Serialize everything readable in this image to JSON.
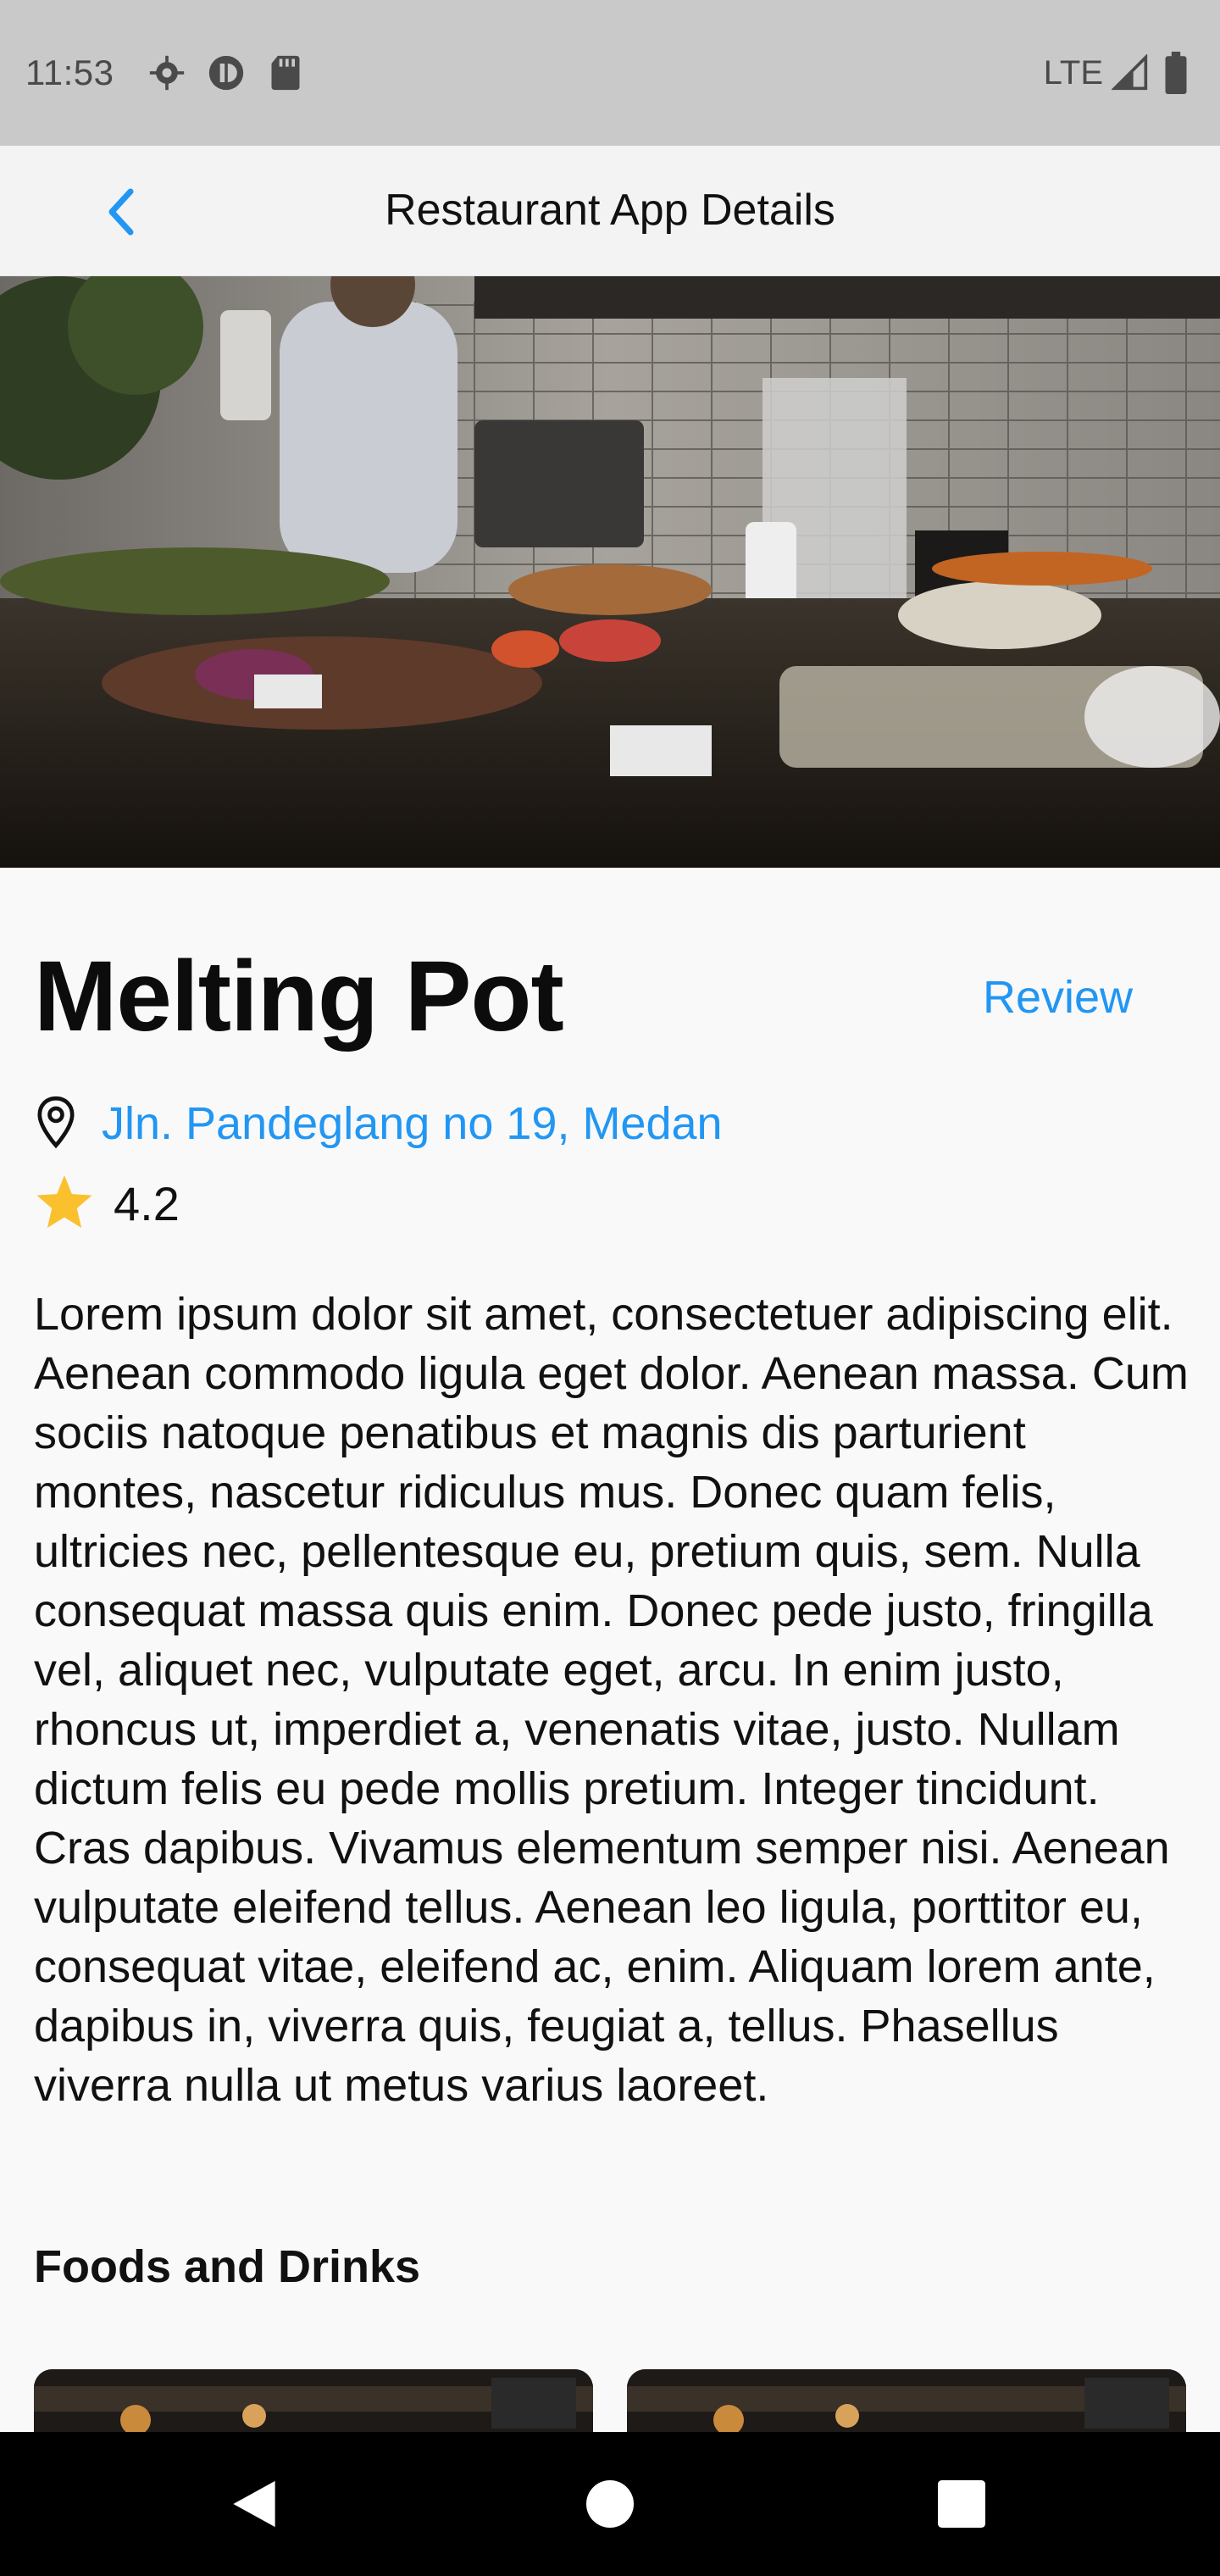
{
  "status_bar": {
    "time": "11:53",
    "network": "LTE",
    "icons": [
      "settings-icon",
      "privacy-icon",
      "sd-card-icon",
      "signal-icon",
      "battery-icon"
    ]
  },
  "app_bar": {
    "title": "Restaurant App Details",
    "back_icon": "chevron-left-icon"
  },
  "restaurant": {
    "name": "Melting Pot",
    "review_label": "Review",
    "address": "Jln. Pandeglang no 19, Medan",
    "rating": "4.2",
    "description": "Lorem ipsum dolor sit amet, consectetuer adipiscing elit. Aenean commodo ligula eget dolor. Aenean massa. Cum sociis natoque penatibus et magnis dis parturient montes, nascetur ridiculus mus. Donec quam felis, ultricies nec, pellentesque eu, pretium quis, sem. Nulla consequat massa quis enim. Donec pede justo, fringilla vel, aliquet nec, vulputate eget, arcu. In enim justo, rhoncus ut, imperdiet a, venenatis vitae, justo. Nullam dictum felis eu pede mollis pretium. Integer tincidunt. Cras dapibus. Vivamus elementum semper nisi. Aenean vulputate eleifend tellus. Aenean leo ligula, porttitor eu, consequat vitae, eleifend ac, enim. Aliquam lorem ante, dapibus in, viverra quis, feugiat a, tellus. Phasellus viverra nulla ut metus varius laoreet."
  },
  "menu": {
    "section_title": "Foods and Drinks",
    "cards": 2
  },
  "nav_bar": {
    "icons": [
      "back-triangle-icon",
      "home-circle-icon",
      "recents-square-icon"
    ]
  },
  "colors": {
    "accent": "#2196f3",
    "star": "#fbc02d",
    "status_bar_bg": "#c9c9c9",
    "nav_bar_bg": "#000000"
  }
}
